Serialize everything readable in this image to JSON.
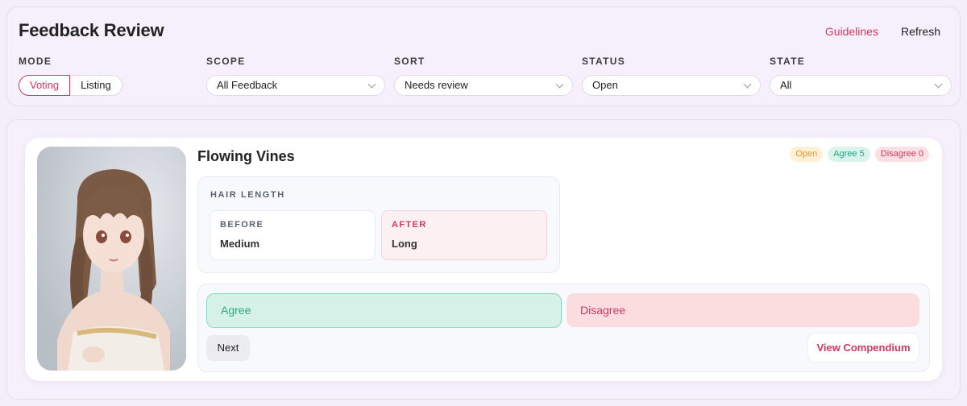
{
  "header": {
    "title": "Feedback Review",
    "guidelines_label": "Guidelines",
    "refresh_label": "Refresh"
  },
  "filters": {
    "mode": {
      "label": "MODE",
      "options": [
        "Voting",
        "Listing"
      ],
      "selected": "Voting"
    },
    "scope": {
      "label": "SCOPE",
      "value": "All Feedback"
    },
    "sort": {
      "label": "SORT",
      "value": "Needs review"
    },
    "status": {
      "label": "STATUS",
      "value": "Open"
    },
    "state": {
      "label": "STATE",
      "value": "All"
    }
  },
  "card": {
    "title": "Flowing Vines",
    "badges": {
      "status": "Open",
      "agree": "Agree 5",
      "disagree": "Disagree 0"
    },
    "attribute": {
      "label": "HAIR LENGTH",
      "before_label": "BEFORE",
      "before_value": "Medium",
      "after_label": "AFTER",
      "after_value": "Long"
    },
    "actions": {
      "agree_label": "Agree",
      "disagree_label": "Disagree",
      "next_label": "Next",
      "compendium_label": "View Compendium"
    }
  },
  "colors": {
    "accent": "#d6375f",
    "agree": "#2aa581",
    "open": "#d69a2a"
  }
}
